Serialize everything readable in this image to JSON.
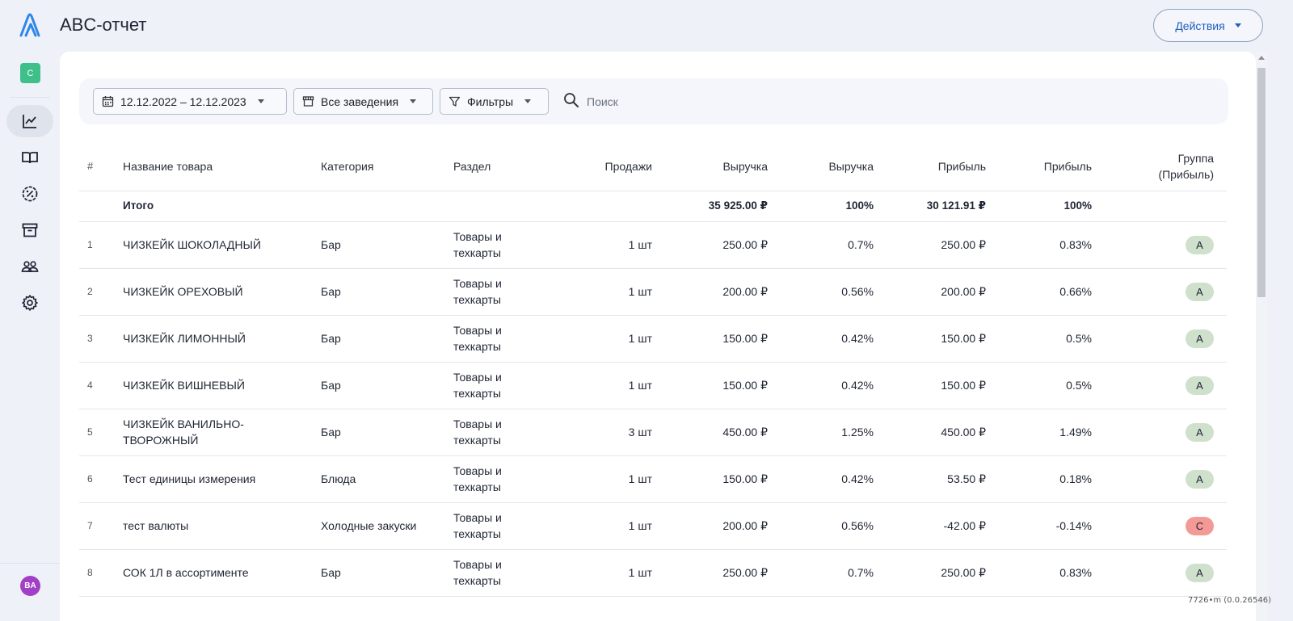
{
  "header": {
    "title": "ABC-отчет",
    "actions_label": "Действия"
  },
  "sidebar": {
    "org_badge": "C",
    "avatar": "BA",
    "items": [
      {
        "name": "analytics",
        "icon": "chart-line-icon",
        "active": true
      },
      {
        "name": "menu",
        "icon": "book-open-icon",
        "active": false
      },
      {
        "name": "discounts",
        "icon": "percent-badge-icon",
        "active": false
      },
      {
        "name": "warehouse",
        "icon": "archive-box-icon",
        "active": false
      },
      {
        "name": "staff",
        "icon": "users-icon",
        "active": false
      },
      {
        "name": "settings",
        "icon": "gear-icon",
        "active": false
      }
    ]
  },
  "filters": {
    "date_range": "12.12.2022 – 12.12.2023",
    "venues": "Все заведения",
    "filters_label": "Фильтры",
    "search_placeholder": "Поиск"
  },
  "table": {
    "columns": {
      "num": "#",
      "name": "Название товара",
      "category": "Категория",
      "section": "Раздел",
      "sales": "Продажи",
      "revenue": "Выручка",
      "revenue_pct": "Выручка",
      "profit": "Прибыль",
      "profit_pct": "Прибыль",
      "group_line1": "Группа",
      "group_line2": "(Прибыль)"
    },
    "total": {
      "label": "Итого",
      "revenue": "35 925.00 ₽",
      "revenue_pct": "100%",
      "profit": "30 121.91 ₽",
      "profit_pct": "100%"
    },
    "rows": [
      {
        "num": "1",
        "name": "ЧИЗКЕЙК ШОКОЛАДНЫЙ",
        "category": "Бар",
        "section": "Товары и техкарты",
        "sales": "1 шт",
        "revenue": "250.00 ₽",
        "revenue_pct": "0.7%",
        "profit": "250.00 ₽",
        "profit_pct": "0.83%",
        "group": "A"
      },
      {
        "num": "2",
        "name": "ЧИЗКЕЙК ОРЕХОВЫЙ",
        "category": "Бар",
        "section": "Товары и техкарты",
        "sales": "1 шт",
        "revenue": "200.00 ₽",
        "revenue_pct": "0.56%",
        "profit": "200.00 ₽",
        "profit_pct": "0.66%",
        "group": "A"
      },
      {
        "num": "3",
        "name": "ЧИЗКЕЙК ЛИМОННЫЙ",
        "category": "Бар",
        "section": "Товары и техкарты",
        "sales": "1 шт",
        "revenue": "150.00 ₽",
        "revenue_pct": "0.42%",
        "profit": "150.00 ₽",
        "profit_pct": "0.5%",
        "group": "A"
      },
      {
        "num": "4",
        "name": "ЧИЗКЕЙК ВИШНЕВЫЙ",
        "category": "Бар",
        "section": "Товары и техкарты",
        "sales": "1 шт",
        "revenue": "150.00 ₽",
        "revenue_pct": "0.42%",
        "profit": "150.00 ₽",
        "profit_pct": "0.5%",
        "group": "A"
      },
      {
        "num": "5",
        "name": "ЧИЗКЕЙК ВАНИЛЬНО-ТВОРОЖНЫЙ",
        "category": "Бар",
        "section": "Товары и техкарты",
        "sales": "3 шт",
        "revenue": "450.00 ₽",
        "revenue_pct": "1.25%",
        "profit": "450.00 ₽",
        "profit_pct": "1.49%",
        "group": "A"
      },
      {
        "num": "6",
        "name": "Тест единицы измерения",
        "category": "Блюда",
        "section": "Товары и техкарты",
        "sales": "1 шт",
        "revenue": "150.00 ₽",
        "revenue_pct": "0.42%",
        "profit": "53.50 ₽",
        "profit_pct": "0.18%",
        "group": "A"
      },
      {
        "num": "7",
        "name": "тест валюты",
        "category": "Холодные закуски",
        "section": "Товары и техкарты",
        "sales": "1 шт",
        "revenue": "200.00 ₽",
        "revenue_pct": "0.56%",
        "profit": "-42.00 ₽",
        "profit_pct": "-0.14%",
        "group": "C"
      },
      {
        "num": "8",
        "name": "СОК 1Л в ассортименте",
        "category": "Бар",
        "section": "Товары и техкарты",
        "sales": "1 шт",
        "revenue": "250.00 ₽",
        "revenue_pct": "0.7%",
        "profit": "250.00 ₽",
        "profit_pct": "0.83%",
        "group": "A"
      }
    ]
  },
  "footer_note": "7726•m (0.0.26546)",
  "colors": {
    "accent": "#1f5fbf",
    "group_a": "#cfe0cc",
    "group_c": "#f49a96",
    "org_badge": "#3fbf8a",
    "avatar": "#a23fc7"
  }
}
